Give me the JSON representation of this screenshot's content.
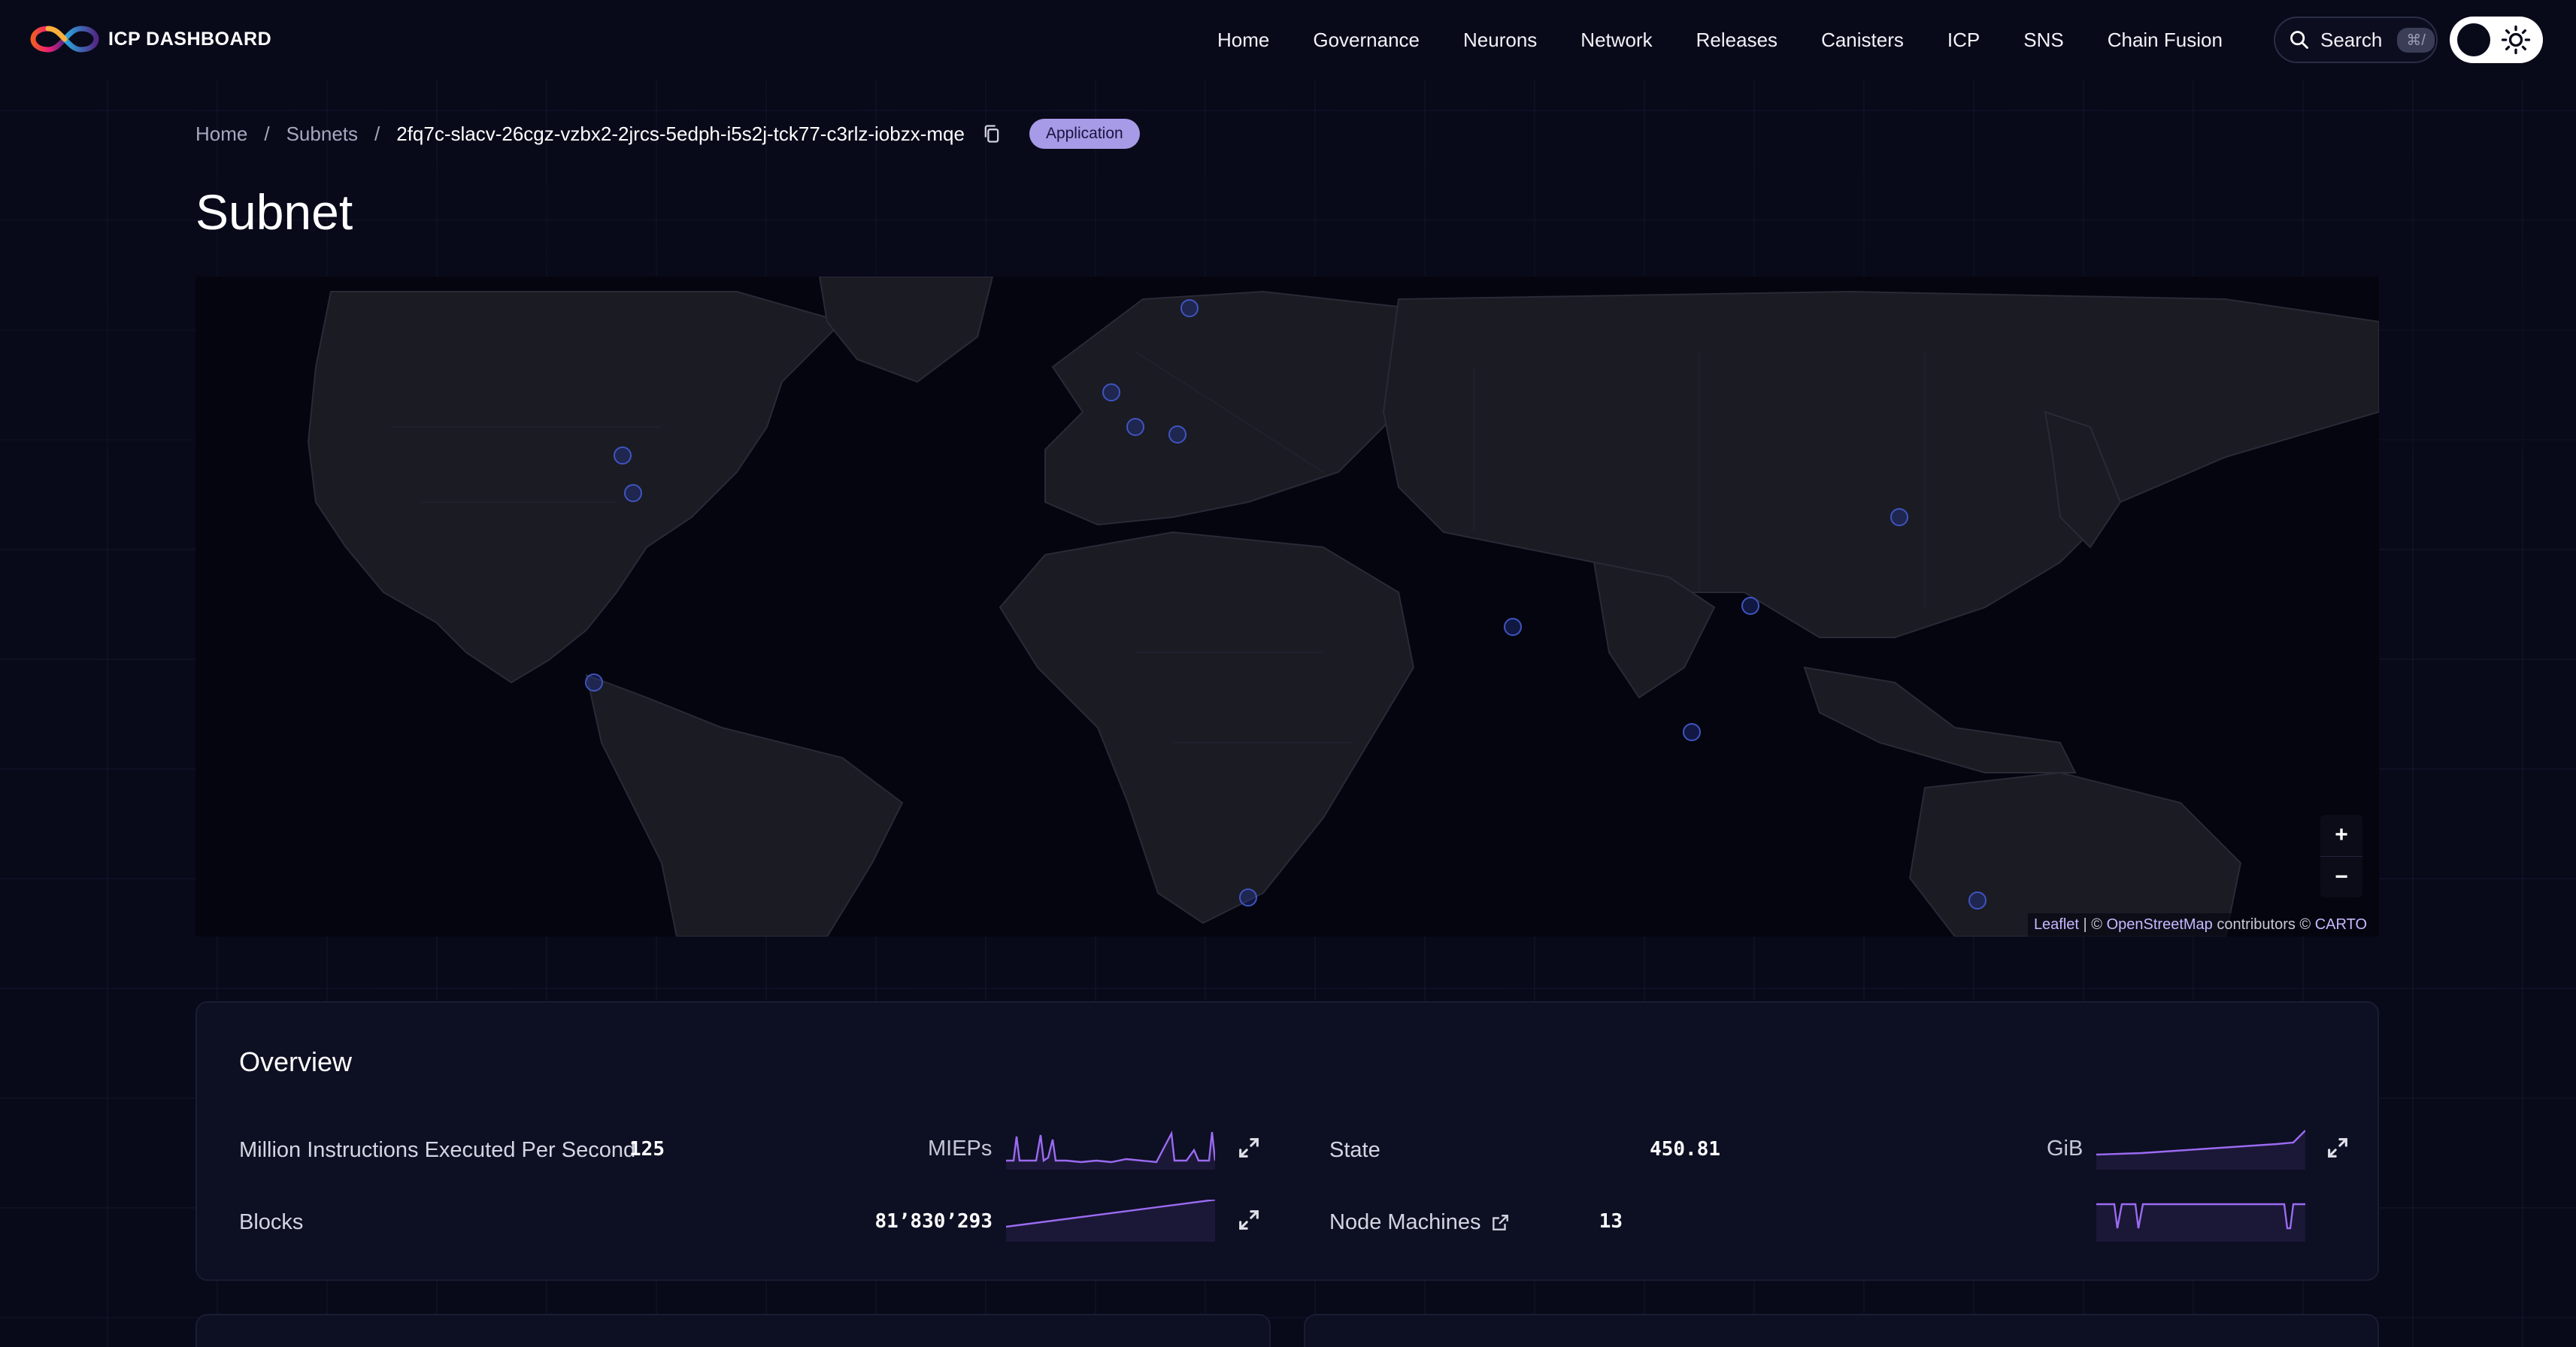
{
  "brand": {
    "name": "ICP DASHBOARD"
  },
  "nav": {
    "items": [
      "Home",
      "Governance",
      "Neurons",
      "Network",
      "Releases",
      "Canisters",
      "ICP",
      "SNS",
      "Chain Fusion"
    ]
  },
  "search": {
    "label": "Search",
    "shortcut": "⌘/"
  },
  "breadcrumb": {
    "home": "Home",
    "subnets": "Subnets",
    "current": "2fq7c-slacv-26cgz-vzbx2-2jrcs-5edph-i5s2j-tck77-c3rlz-iobzx-mqe",
    "badge": "Application"
  },
  "page": {
    "title": "Subnet"
  },
  "map": {
    "zoom_in": "+",
    "zoom_out": "−",
    "attribution": {
      "leaflet": "Leaflet",
      "sep": " | © ",
      "osm": "OpenStreetMap",
      "contrib": " contributors © ",
      "carto": "CARTO"
    }
  },
  "overview": {
    "title": "Overview",
    "metrics": {
      "mieps": {
        "label": "Million Instructions Executed Per Second",
        "value": "125",
        "unit": "MIEPs"
      },
      "state": {
        "label": "State",
        "value": "450.81",
        "unit": "GiB"
      },
      "blocks": {
        "label": "Blocks",
        "value": "81’830’293",
        "unit": ""
      },
      "nodes": {
        "label": "Node Machines",
        "value": "13",
        "unit": ""
      }
    }
  },
  "colors": {
    "accent": "#9b6bf2",
    "badge_bg": "#a79ae6",
    "background": "#080a1a",
    "node_dot": "#3f55c0"
  },
  "icons": {
    "logo": "infinity-logo-icon",
    "search": "search-icon",
    "theme": "sun-icon",
    "copy": "copy-icon",
    "expand": "expand-icon",
    "external": "external-link-icon"
  }
}
